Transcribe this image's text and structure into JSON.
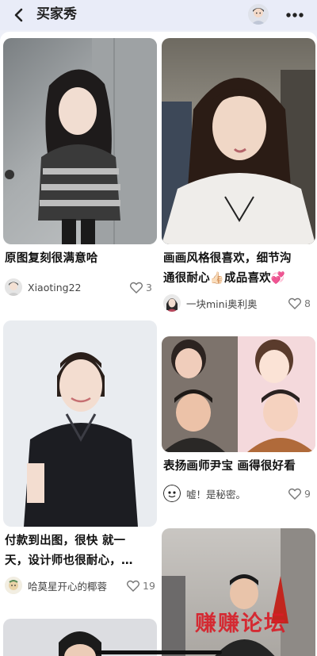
{
  "header": {
    "title": "买家秀",
    "back_icon": "chevron-left-icon",
    "avatar_icon": "user-avatar",
    "more_icon": "more-dots-icon"
  },
  "cards": [
    {
      "caption_lines": [
        "原图复刻很满意哈"
      ],
      "author": "Xiaoting22",
      "likes": "3"
    },
    {
      "caption_lines": [
        "画画风格很喜欢，细节沟",
        "通很耐心👍🏻成品喜欢💞"
      ],
      "author": "一块mini奥利奥",
      "likes": "8"
    },
    {
      "caption_lines": [
        "付款到出图，很快 就一",
        "天，设计师也很耐心，…"
      ],
      "author": "哈莫星开心的椰蓉",
      "likes": "19"
    },
    {
      "caption_lines": [
        "表扬画师尹宝 画得很好看"
      ],
      "author": "嘘！是秘密。",
      "likes": "9"
    },
    {
      "watermark": "赚赚论坛"
    }
  ],
  "colors": {
    "header_bg": "#e9ecf8",
    "card_bg": "#ffffff",
    "text": "#111111",
    "muted": "#777777",
    "watermark": "#d71e28"
  }
}
